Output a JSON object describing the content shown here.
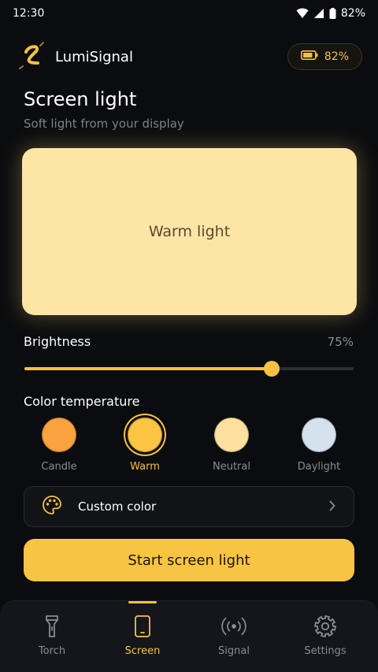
{
  "status_bar": {
    "time": "12:30",
    "battery": "82%"
  },
  "header": {
    "app_name": "LumiSignal",
    "battery_level": "82%"
  },
  "page": {
    "title": "Screen light",
    "subtitle": "Soft light from your display"
  },
  "preview": {
    "label": "Warm light",
    "color": "#fde5a6"
  },
  "brightness": {
    "label": "Brightness",
    "value_text": "75%",
    "value": 0.75
  },
  "color_temperature": {
    "label": "Color temperature",
    "options": [
      {
        "name": "Candle",
        "color": "#f9a23f"
      },
      {
        "name": "Warm",
        "color": "#fbc443",
        "selected": true
      },
      {
        "name": "Neutral",
        "color": "#fde09e"
      },
      {
        "name": "Daylight",
        "color": "#d4e1ef"
      }
    ]
  },
  "custom_color": {
    "label": "Custom color"
  },
  "start_button": {
    "label": "Start screen light"
  },
  "nav": {
    "items": [
      {
        "label": "Torch",
        "icon": "flashlight-icon"
      },
      {
        "label": "Screen",
        "icon": "phone-icon",
        "active": true
      },
      {
        "label": "Signal",
        "icon": "broadcast-icon"
      },
      {
        "label": "Settings",
        "icon": "gear-icon"
      }
    ]
  },
  "colors": {
    "accent": "#f7c242",
    "background": "#0b0c0f",
    "muted": "#8a8d95"
  }
}
